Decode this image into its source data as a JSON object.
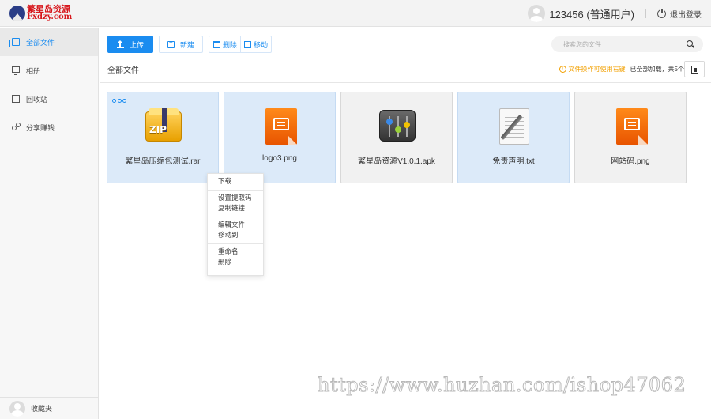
{
  "header": {
    "logo_line1": "繁星岛资源",
    "logo_line2": "Fxdzy.com",
    "username": "123456 (普通用户)",
    "logout_label": "退出登录"
  },
  "sidebar": {
    "items": [
      {
        "label": "全部文件",
        "icon": "files-icon",
        "active": true
      },
      {
        "label": "相册",
        "icon": "monitor-icon",
        "active": false
      },
      {
        "label": "回收站",
        "icon": "trash-icon",
        "active": false
      },
      {
        "label": "分享赚钱",
        "icon": "share-icon",
        "active": false
      }
    ],
    "bottom_label": "收藏夹"
  },
  "toolbar": {
    "upload_label": "上传",
    "new_label": "新建",
    "delete_label": "删除",
    "move_label": "移动"
  },
  "search": {
    "placeholder": "搜索您的文件"
  },
  "breadcrumb": "全部文件",
  "tip": {
    "text": "文件操作可使用右键",
    "loaded": "已全部加载，共5个"
  },
  "files": [
    {
      "name": "繁星岛压缩包测试.rar",
      "icon": "zip-icon",
      "selected": true
    },
    {
      "name": "logo3.png",
      "icon": "image-file-icon",
      "selected": true
    },
    {
      "name": "繁星岛资源V1.0.1.apk",
      "icon": "apk-icon",
      "selected": false
    },
    {
      "name": "免责声明.txt",
      "icon": "text-file-icon",
      "selected": true
    },
    {
      "name": "网站码.png",
      "icon": "image-file-icon",
      "selected": false
    }
  ],
  "context_menu": {
    "download": "下载",
    "set_code": "设置提取码",
    "copy_link": "复制链接",
    "edit_file": "编辑文件",
    "move_to": "移动到",
    "rename": "重命名",
    "delete": "删除"
  },
  "watermark": "https://www.huzhan.com/ishop47062",
  "colors": {
    "accent": "#1a8cf0",
    "selected_bg": "#dceaf9",
    "tip": "#f2a000",
    "logo": "#d7161b"
  }
}
